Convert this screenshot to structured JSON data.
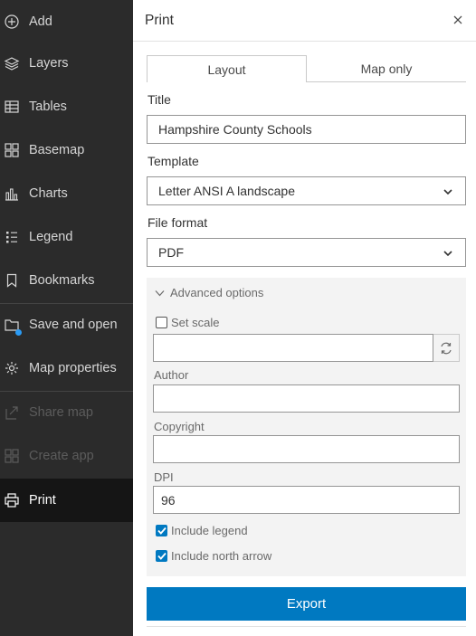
{
  "sidebar": {
    "items": [
      {
        "label": "Add",
        "icon": "add-circle-icon",
        "disabled": false
      },
      {
        "label": "Layers",
        "icon": "layers-icon",
        "disabled": false
      },
      {
        "label": "Tables",
        "icon": "table-icon",
        "disabled": false
      },
      {
        "label": "Basemap",
        "icon": "basemap-icon",
        "disabled": false
      },
      {
        "label": "Charts",
        "icon": "chart-icon",
        "disabled": false
      },
      {
        "label": "Legend",
        "icon": "legend-icon",
        "disabled": false
      },
      {
        "label": "Bookmarks",
        "icon": "bookmark-icon",
        "disabled": false
      },
      {
        "label": "Save and open",
        "icon": "folder-icon",
        "disabled": false
      },
      {
        "label": "Map properties",
        "icon": "gear-icon",
        "disabled": false
      },
      {
        "label": "Share map",
        "icon": "share-icon",
        "disabled": true
      },
      {
        "label": "Create app",
        "icon": "app-grid-icon",
        "disabled": true
      },
      {
        "label": "Print",
        "icon": "printer-icon",
        "disabled": false,
        "active": true
      }
    ]
  },
  "panel": {
    "title": "Print",
    "tabs": [
      {
        "label": "Layout",
        "selected": true
      },
      {
        "label": "Map only",
        "selected": false
      }
    ],
    "title_field": {
      "label": "Title",
      "value": "Hampshire County Schools"
    },
    "template_field": {
      "label": "Template",
      "value": "Letter ANSI A landscape"
    },
    "format_field": {
      "label": "File format",
      "value": "PDF"
    },
    "advanced": {
      "toggle_label": "Advanced options",
      "set_scale_label": "Set scale",
      "set_scale_checked": false,
      "scale_value": "",
      "author_label": "Author",
      "author_value": "",
      "copyright_label": "Copyright",
      "copyright_value": "",
      "dpi_label": "DPI",
      "dpi_value": "96",
      "include_legend_label": "Include legend",
      "include_legend_checked": true,
      "include_north_arrow_label": "Include north arrow",
      "include_north_arrow_checked": true
    },
    "export_label": "Export"
  },
  "colors": {
    "sidebar_bg": "#2b2b2b",
    "sidebar_active_bg": "#151515",
    "accent": "#0079c1",
    "notify_dot": "#2b9bf4"
  }
}
